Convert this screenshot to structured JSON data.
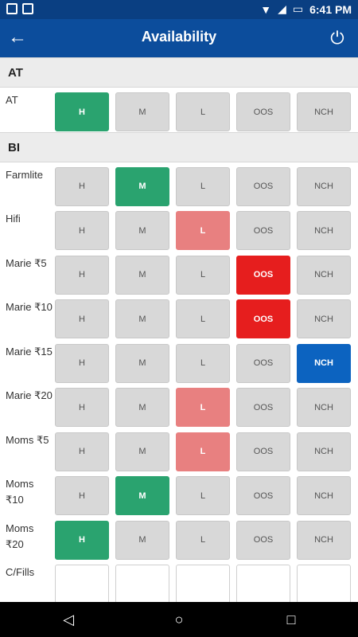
{
  "status": {
    "time": "6:41 PM"
  },
  "appbar": {
    "title": "Availability"
  },
  "options": [
    "H",
    "M",
    "L",
    "OOS",
    "NCH"
  ],
  "sections": [
    {
      "name": "AT",
      "rows": [
        {
          "label": "AT",
          "selected": "H"
        }
      ]
    },
    {
      "name": "BI",
      "rows": [
        {
          "label": "Farmlite",
          "selected": "M"
        },
        {
          "label": "Hifi",
          "selected": "L"
        },
        {
          "label": "Marie ₹5",
          "selected": "OOS"
        },
        {
          "label": "Marie ₹10",
          "selected": "OOS"
        },
        {
          "label": "Marie ₹15",
          "selected": "NCH"
        },
        {
          "label": "Marie ₹20",
          "selected": "L"
        },
        {
          "label": "Moms ₹5",
          "selected": "L"
        },
        {
          "label": "Moms ₹10",
          "selected": "M"
        },
        {
          "label": "Moms ₹20",
          "selected": "H"
        },
        {
          "label": "C/Fills",
          "selected": ""
        }
      ]
    }
  ]
}
